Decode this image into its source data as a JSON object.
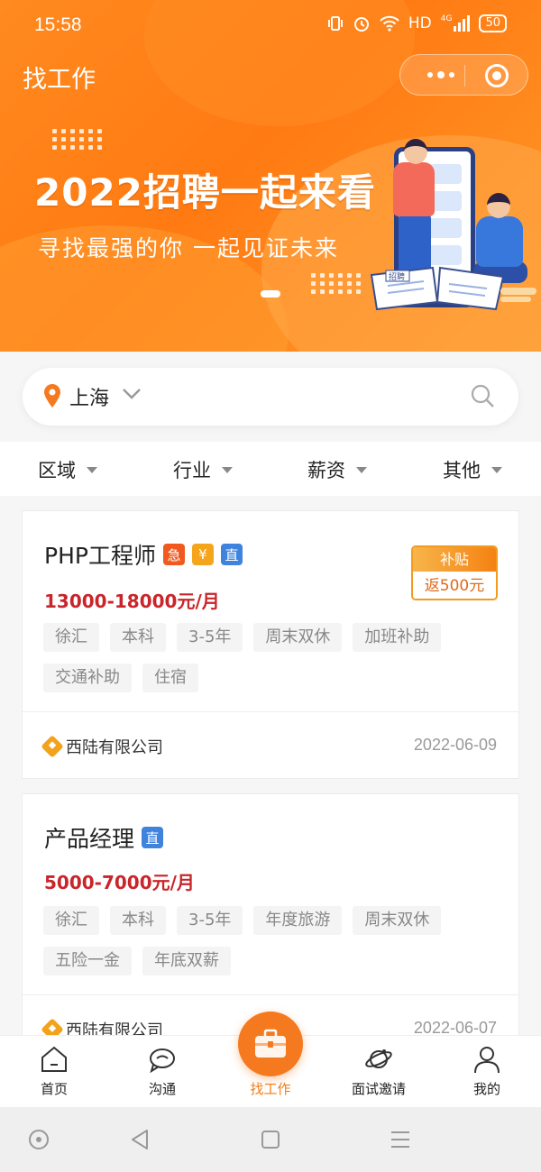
{
  "status_bar": {
    "time": "15:58",
    "network": "HD",
    "signal_label": "4G",
    "battery": "50"
  },
  "nav": {
    "title": "找工作"
  },
  "banner": {
    "headline": "2022招聘一起来看",
    "subline": "寻找最强的你  一起见证未来",
    "book_label": "招聘"
  },
  "search": {
    "city": "上海"
  },
  "filters": [
    {
      "label": "区域"
    },
    {
      "label": "行业"
    },
    {
      "label": "薪资"
    },
    {
      "label": "其他"
    }
  ],
  "jobs": [
    {
      "title": "PHP工程师",
      "badges": [
        "急",
        "¥",
        "直"
      ],
      "salary": "13000-18000元/月",
      "tags": [
        "徐汇",
        "本科",
        "3-5年",
        "周末双休",
        "加班补助",
        "交通补助",
        "住宿"
      ],
      "company": "西陆有限公司",
      "date": "2022-06-09",
      "subsidy": {
        "label": "补贴",
        "value": "返500元"
      }
    },
    {
      "title": "产品经理",
      "badges": [
        "直"
      ],
      "salary": "5000-7000元/月",
      "tags": [
        "徐汇",
        "本科",
        "3-5年",
        "年度旅游",
        "周末双休",
        "五险一金",
        "年底双薪"
      ],
      "company": "西陆有限公司",
      "date": "2022-06-07"
    }
  ],
  "tabbar": [
    {
      "label": "首页",
      "icon": "home-icon"
    },
    {
      "label": "沟通",
      "icon": "chat-icon"
    },
    {
      "label": "找工作",
      "icon": "briefcase-icon",
      "active": true
    },
    {
      "label": "面试邀请",
      "icon": "planet-icon"
    },
    {
      "label": "我的",
      "icon": "user-icon"
    }
  ],
  "colors": {
    "accent": "#f57a1f",
    "salary": "#c9252b",
    "verified": "#3f83dd"
  }
}
